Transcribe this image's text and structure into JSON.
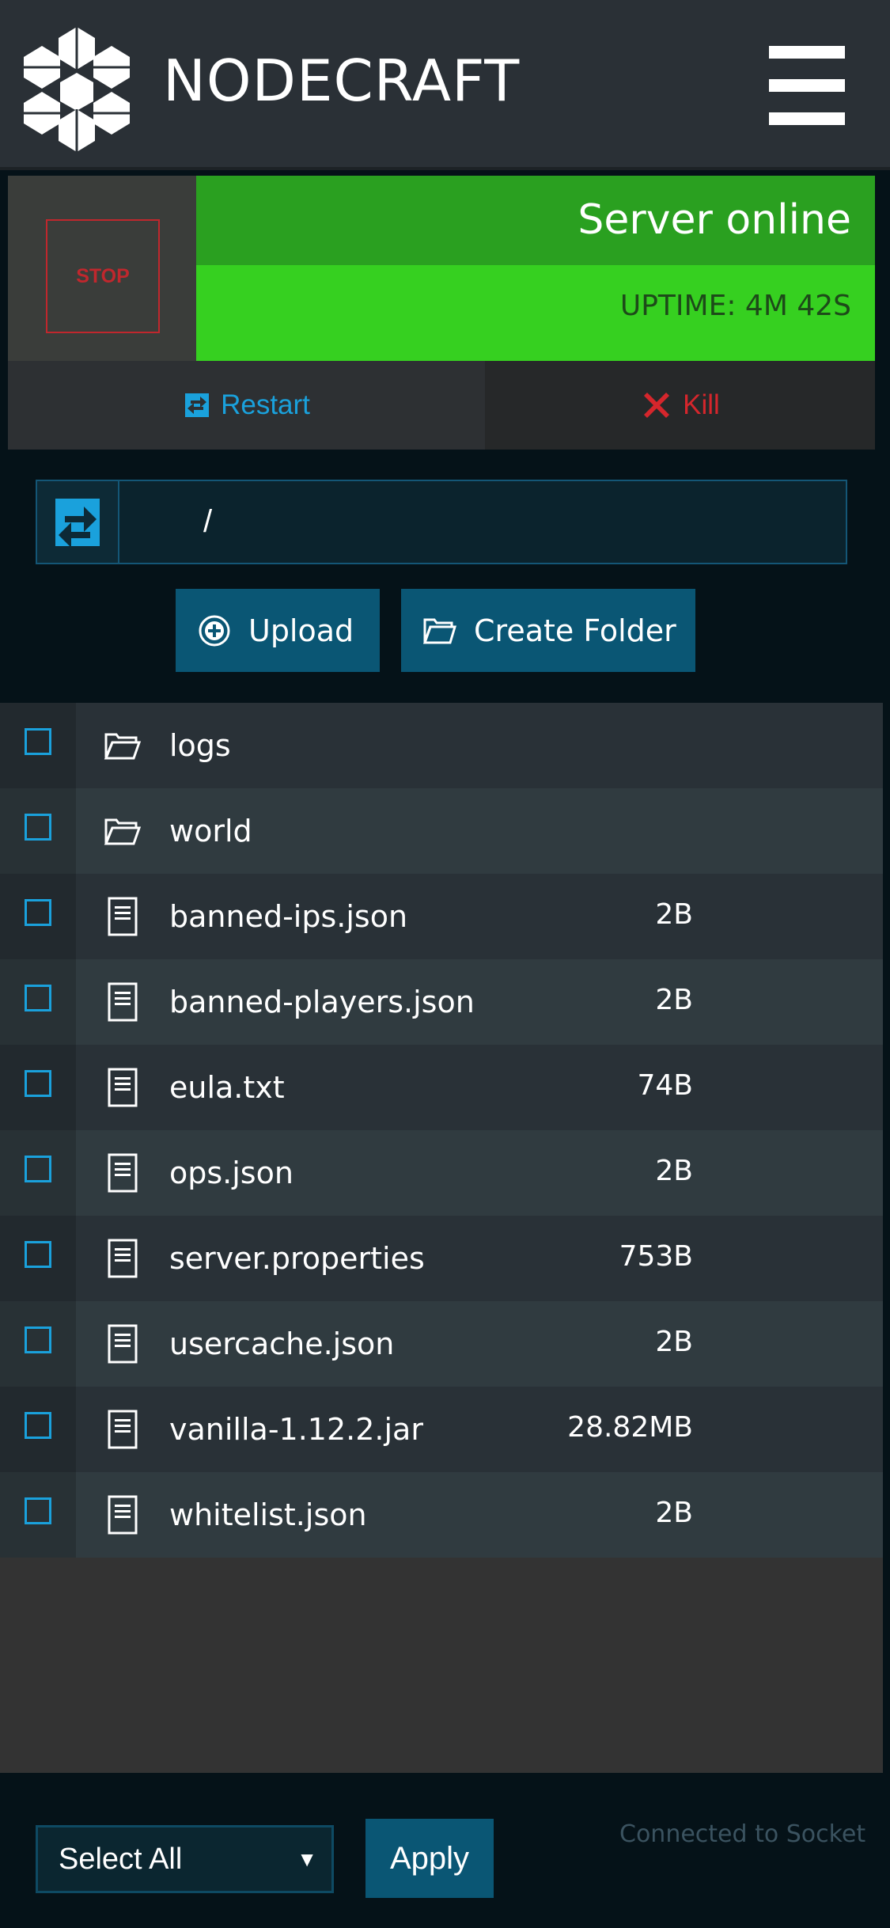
{
  "header": {
    "brand": "NODECRAFT",
    "logo_icon": "nodecraft-logo-icon",
    "menu_icon": "hamburger-menu-icon"
  },
  "server": {
    "stop_label": "STOP",
    "status": "Server online",
    "uptime": "UPTIME: 4M 42S",
    "restart_label": "Restart",
    "kill_label": "Kill",
    "colors": {
      "online": "#2aa020",
      "uptime": "#36d020",
      "stop": "#c0272d",
      "restart": "#1aa1dc"
    }
  },
  "file_manager": {
    "path": "/",
    "upload_label": "Upload",
    "create_folder_label": "Create Folder",
    "files": [
      {
        "name": "logs",
        "size": "",
        "type": "folder"
      },
      {
        "name": "world",
        "size": "",
        "type": "folder"
      },
      {
        "name": "banned-ips.json",
        "size": "2B",
        "type": "file"
      },
      {
        "name": "banned-players.json",
        "size": "2B",
        "type": "file"
      },
      {
        "name": "eula.txt",
        "size": "74B",
        "type": "file"
      },
      {
        "name": "ops.json",
        "size": "2B",
        "type": "file"
      },
      {
        "name": "server.properties",
        "size": "753B",
        "type": "file"
      },
      {
        "name": "usercache.json",
        "size": "2B",
        "type": "file"
      },
      {
        "name": "vanilla-1.12.2.jar",
        "size": "28.82MB",
        "type": "file"
      },
      {
        "name": "whitelist.json",
        "size": "2B",
        "type": "file"
      }
    ]
  },
  "footer": {
    "select_value": "Select All",
    "apply_label": "Apply",
    "socket_status": "Connected to Socket"
  }
}
